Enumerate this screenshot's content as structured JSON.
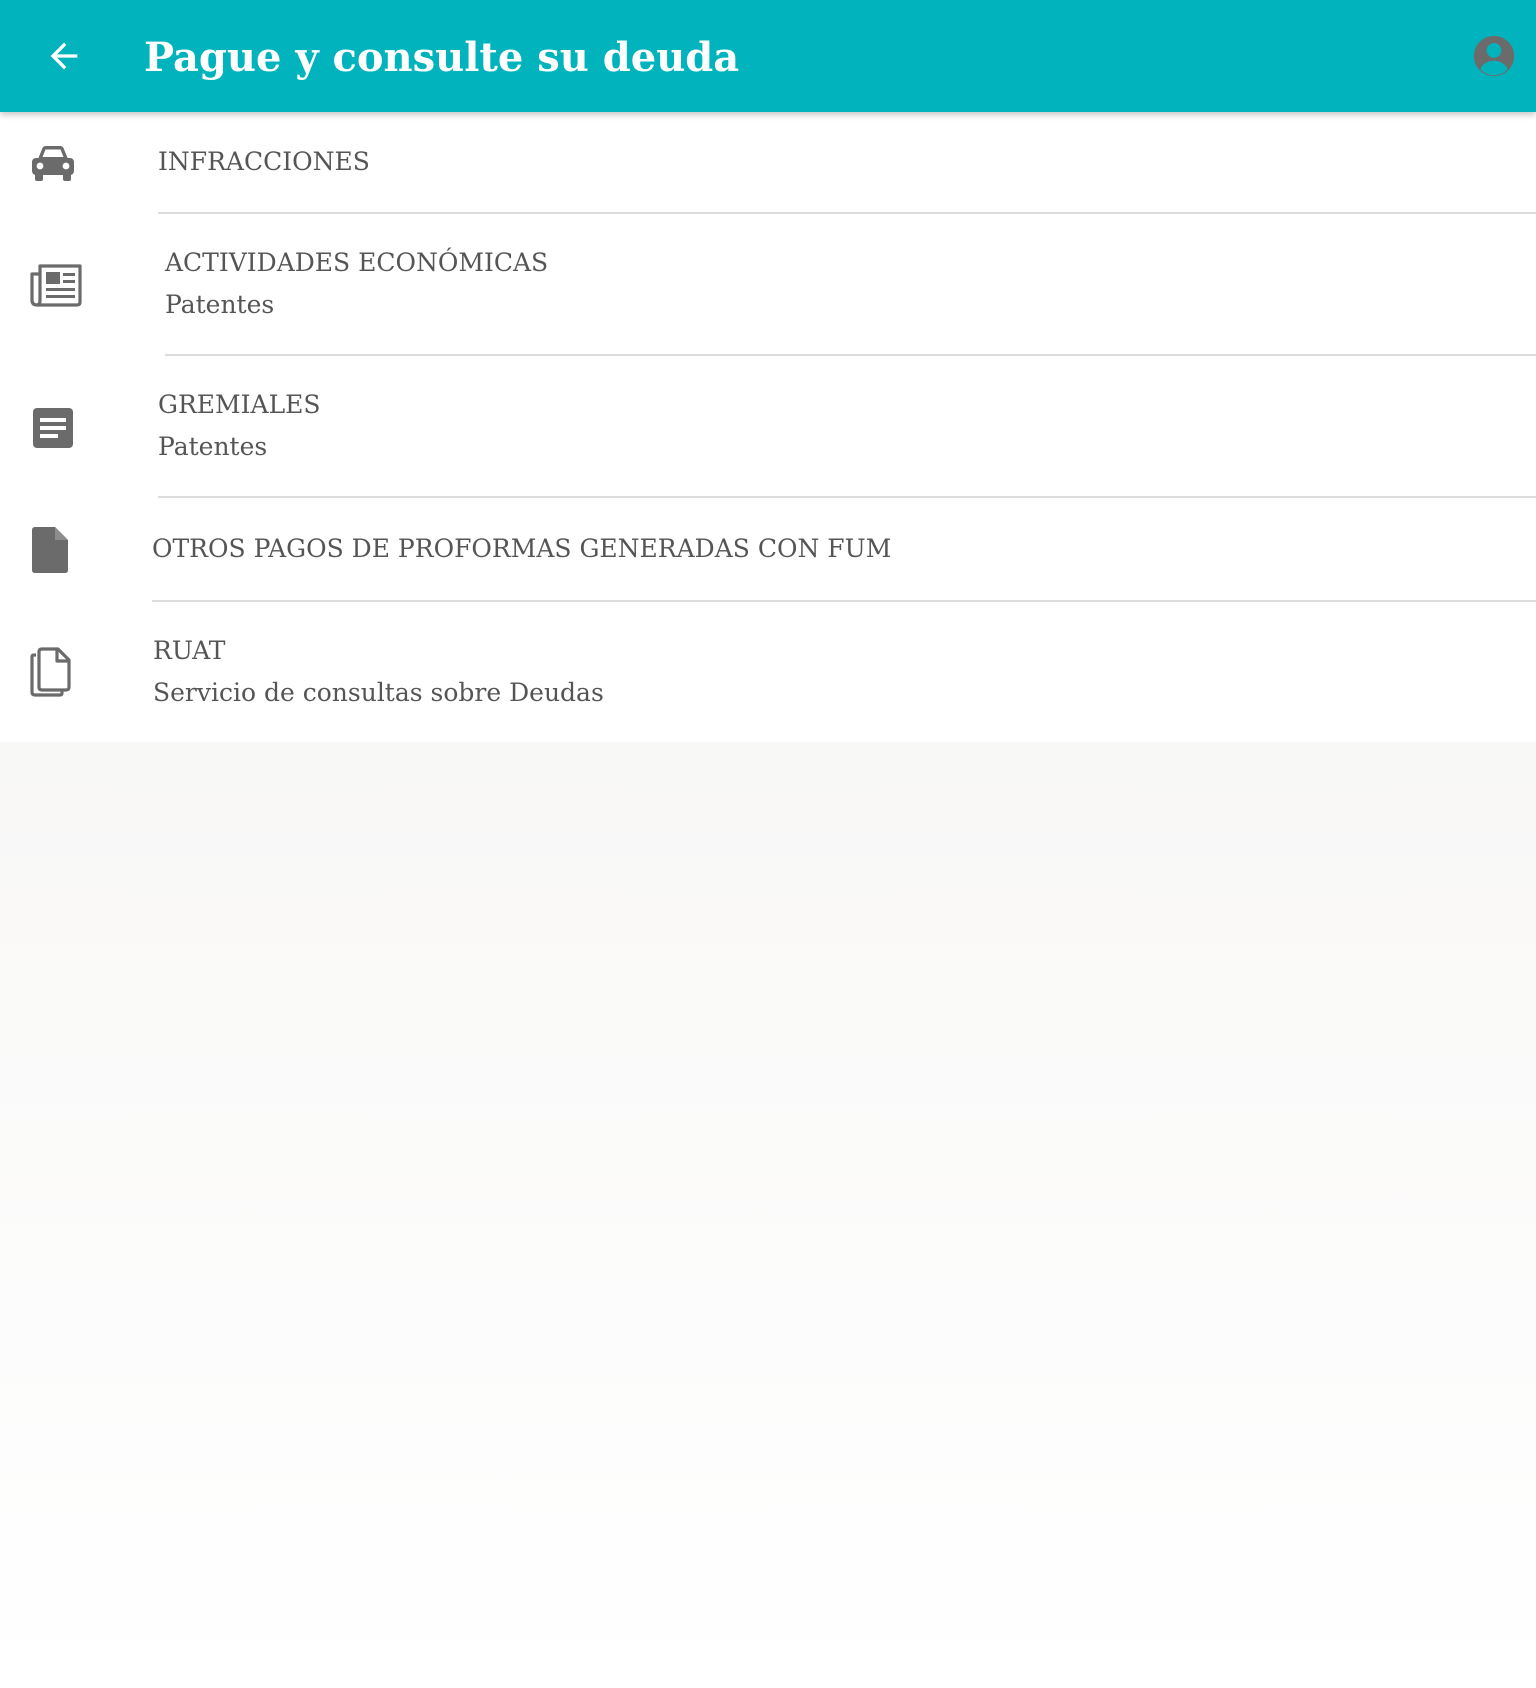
{
  "appbar": {
    "title": "Pague y consulte su deuda",
    "background_color": "#00b3bc",
    "back_icon": "arrow-left-icon",
    "account_icon": "account-circle-icon"
  },
  "items": [
    {
      "icon": "car-icon",
      "title": "INFRACCIONES",
      "subtitle": ""
    },
    {
      "icon": "newspaper-icon",
      "title": "ACTIVIDADES ECONÓMICAS",
      "subtitle": "Patentes"
    },
    {
      "icon": "notes-icon",
      "title": "GREMIALES",
      "subtitle": "Patentes"
    },
    {
      "icon": "file-icon",
      "title": "OTROS PAGOS DE PROFORMAS GENERADAS CON FUM",
      "subtitle": ""
    },
    {
      "icon": "files-copy-icon",
      "title": "RUAT",
      "subtitle": "Servicio de consultas sobre Deudas"
    }
  ]
}
